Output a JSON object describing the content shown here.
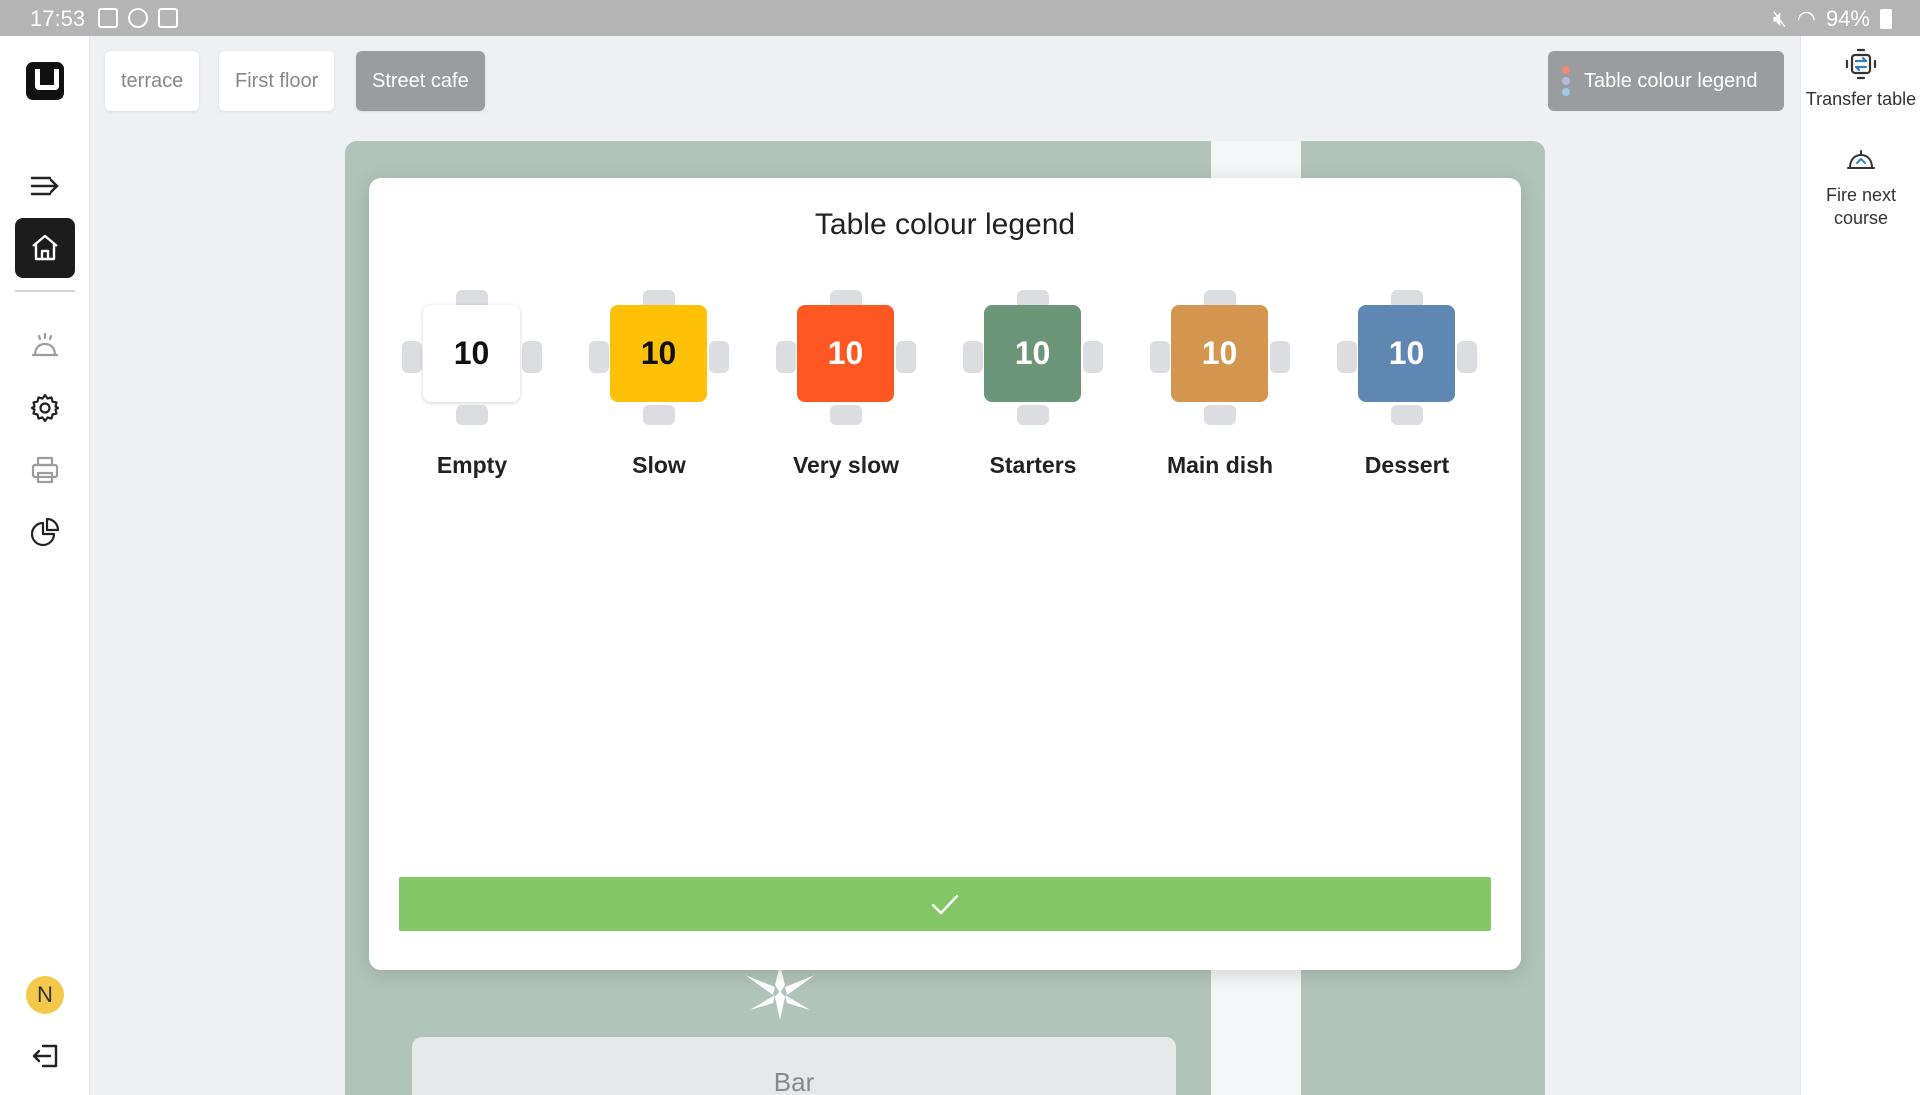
{
  "status_bar": {
    "time": "17:53",
    "battery": "94%"
  },
  "sidebar": {
    "items": [
      {
        "name": "collapse-menu"
      },
      {
        "name": "home",
        "active": true
      },
      {
        "name": "kitchen"
      },
      {
        "name": "settings"
      },
      {
        "name": "print"
      },
      {
        "name": "reports"
      }
    ],
    "avatar_initial": "N"
  },
  "floors": {
    "tabs": [
      {
        "label": "terrace",
        "active": false
      },
      {
        "label": "First floor",
        "active": false
      },
      {
        "label": "Street cafe",
        "active": true
      }
    ],
    "legend_button": "Table colour legend",
    "legend_dot_colors": [
      "#f08a7a",
      "#b9b9d8",
      "#9fc7e6"
    ]
  },
  "right_panel": {
    "transfer_table": "Transfer table",
    "fire_next_course": "Fire next course"
  },
  "floor_plan": {
    "bar_label": "Bar"
  },
  "modal": {
    "title": "Table colour legend",
    "items": [
      {
        "number": "10",
        "label": "Empty",
        "color": "#ffffff",
        "text_color": "#111111"
      },
      {
        "number": "10",
        "label": "Slow",
        "color": "#ffc107",
        "text_color": "#111111"
      },
      {
        "number": "10",
        "label": "Very slow",
        "color": "#ff5722",
        "text_color": "#ffffff"
      },
      {
        "number": "10",
        "label": "Starters",
        "color": "#6b9677",
        "text_color": "#ffffff"
      },
      {
        "number": "10",
        "label": "Main dish",
        "color": "#d4964f",
        "text_color": "#ffffff"
      },
      {
        "number": "10",
        "label": "Dessert",
        "color": "#5e87b3",
        "text_color": "#ffffff"
      }
    ],
    "confirm_icon": "check-icon",
    "confirm_color": "#82c666"
  }
}
